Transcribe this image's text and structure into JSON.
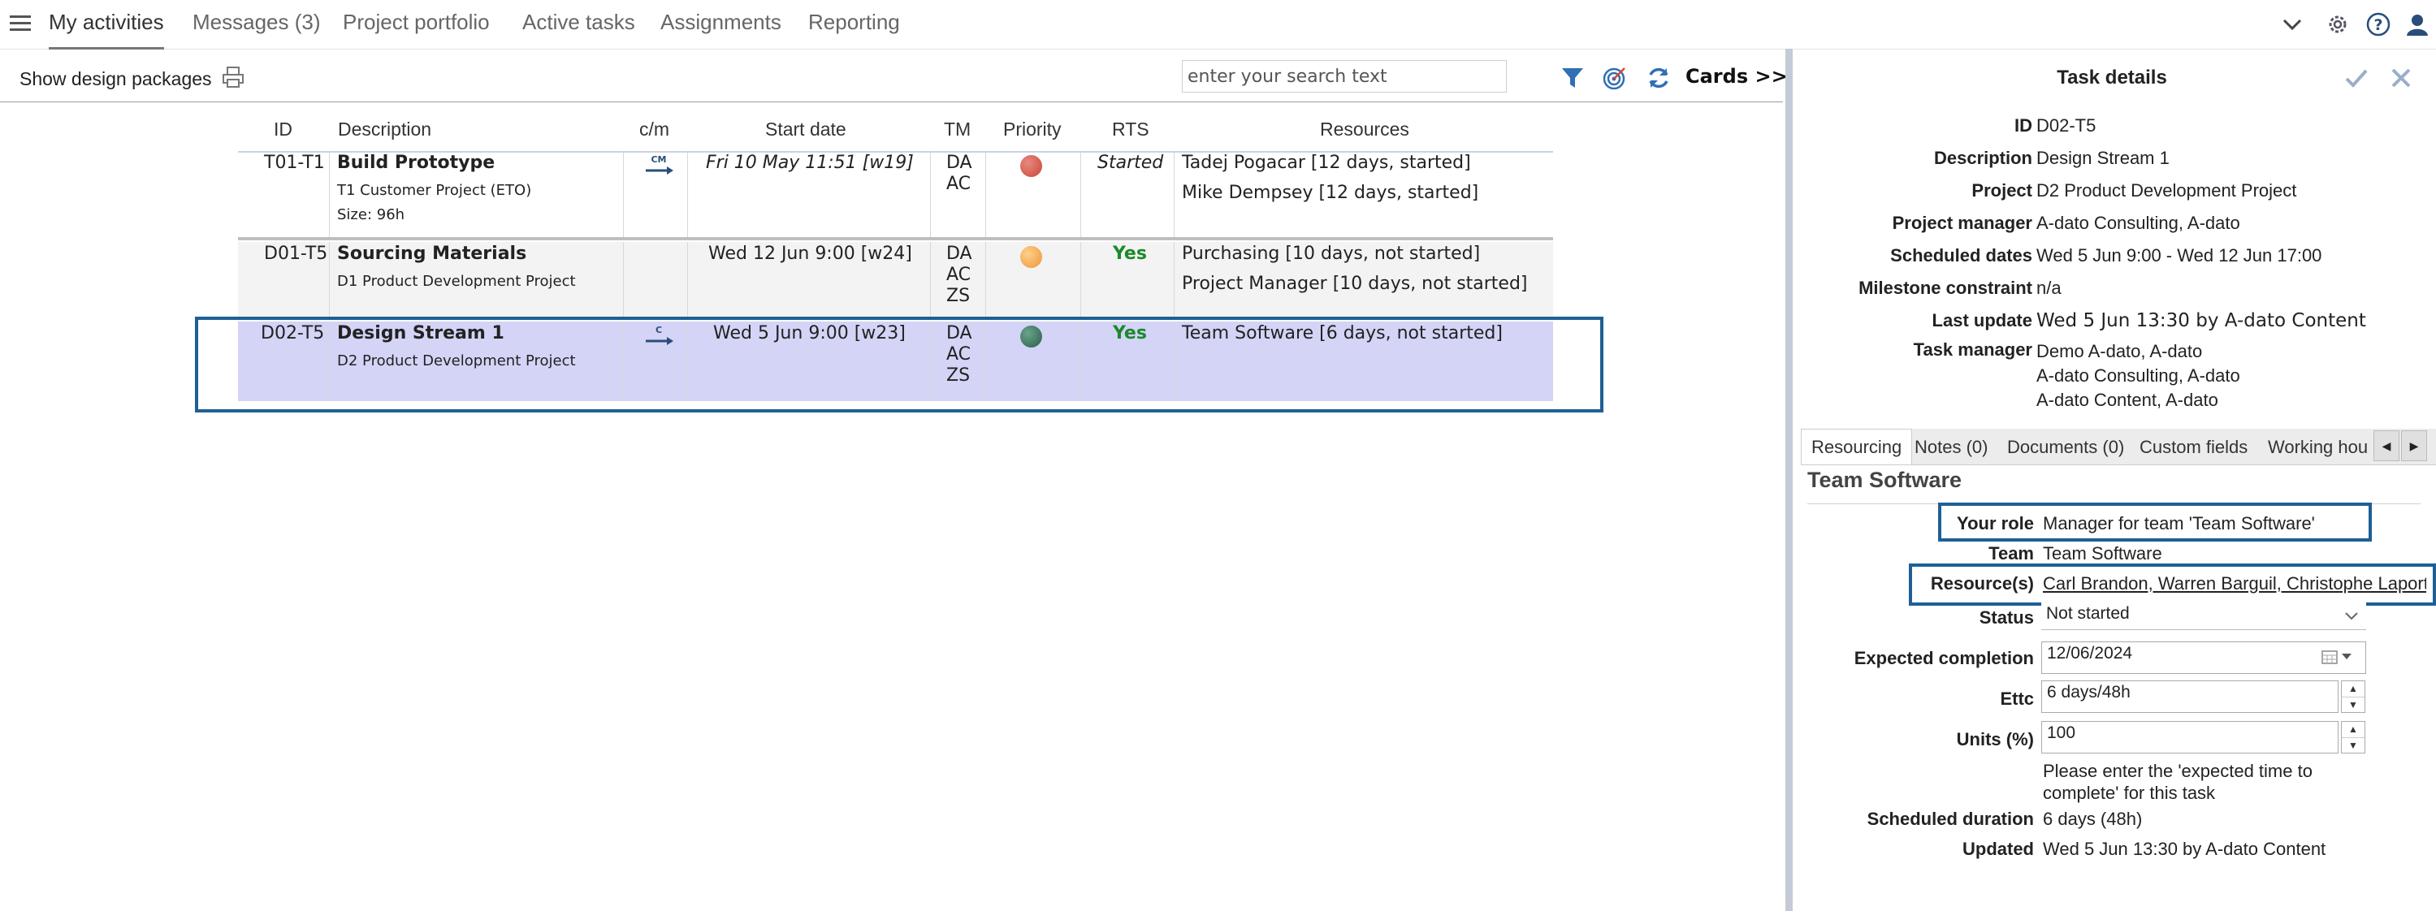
{
  "nav": {
    "tabs": [
      "My activities",
      "Messages (3)",
      "Project portfolio",
      "Active tasks",
      "Assignments",
      "Reporting"
    ],
    "active_index": 0,
    "icons": [
      "menu-icon",
      "chevron-down-icon",
      "gear-icon",
      "help-icon",
      "user-icon"
    ]
  },
  "toolbar": {
    "show_design_packages": "Show design packages",
    "search_placeholder": "enter your search text",
    "cards_label": "Cards >>"
  },
  "table": {
    "headers": [
      "ID",
      "Description",
      "c/m",
      "Start date",
      "TM",
      "Priority",
      "RTS",
      "Resources"
    ],
    "rows": [
      {
        "id": "T01-T1",
        "title": "Build Prototype",
        "subtitle": "T1 Customer Project (ETO)",
        "size": "Size: 96h",
        "cm": "CM",
        "start": "Fri 10 May 11:51 [w19]",
        "tm": [
          "DA",
          "AC"
        ],
        "priority_color": "#d0584a",
        "rts": "Started",
        "resources": [
          "Tadej Pogacar [12 days, started]",
          "Mike Dempsey [12 days, started]"
        ]
      },
      {
        "id": "D01-T5",
        "title": "Sourcing Materials",
        "subtitle": "D1 Product Development Project",
        "cm": "",
        "start": "Wed 12 Jun 9:00 [w24]",
        "tm": [
          "DA",
          "AC",
          "ZS"
        ],
        "priority_color": "#f0a045",
        "rts": "Yes",
        "resources": [
          "Purchasing [10 days, not started]",
          "Project Manager [10 days, not started]"
        ]
      },
      {
        "id": "D02-T5",
        "title": "Design Stream 1",
        "subtitle": "D2 Product Development Project",
        "cm": "C",
        "start": "Wed 5 Jun 9:00 [w23]",
        "tm": [
          "DA",
          "AC",
          "ZS"
        ],
        "priority_color": "#3c7a63",
        "rts": "Yes",
        "resources": [
          "Team Software [6 days, not started]"
        ]
      }
    ]
  },
  "task_details": {
    "title": "Task details",
    "fields": {
      "id_label": "ID",
      "id": "D02-T5",
      "description_label": "Description",
      "description": "Design Stream 1",
      "project_label": "Project",
      "project": "D2 Product Development Project",
      "pm_label": "Project manager",
      "pm": "A-dato Consulting, A-dato",
      "dates_label": "Scheduled dates",
      "dates": "Wed 5 Jun 9:00 - Wed 12 Jun 17:00",
      "milestone_label": "Milestone constraint",
      "milestone": "n/a",
      "last_update_label": "Last update",
      "last_update": "Wed 5 Jun 13:30 by A-dato Content",
      "tm_label": "Task manager",
      "tm": [
        "Demo A-dato, A-dato",
        "A-dato Consulting, A-dato",
        "A-dato Content, A-dato"
      ]
    },
    "tabs": [
      "Resourcing",
      "Notes (0)",
      "Documents (0)",
      "Custom fields",
      "Working hou"
    ],
    "resourcing": {
      "heading": "Team Software",
      "role_label": "Your role",
      "role": "Manager for team 'Team Software'",
      "team_label": "Team",
      "team": "Team Software",
      "resources_label": "Resource(s)",
      "resources": "Carl Brandon, Warren Barguil, Christophe Laport",
      "status_label": "Status",
      "status": "Not started",
      "expected_label": "Expected completion",
      "expected": "12/06/2024",
      "ettc_label": "Ettc",
      "ettc": "6 days/48h",
      "units_label": "Units (%)",
      "units": "100",
      "hint": [
        "Please enter the 'expected time to",
        "complete' for this task"
      ],
      "duration_label": "Scheduled duration",
      "duration": "6 days (48h)",
      "updated_label": "Updated",
      "updated": "Wed 5 Jun 13:30 by A-dato Content"
    }
  }
}
